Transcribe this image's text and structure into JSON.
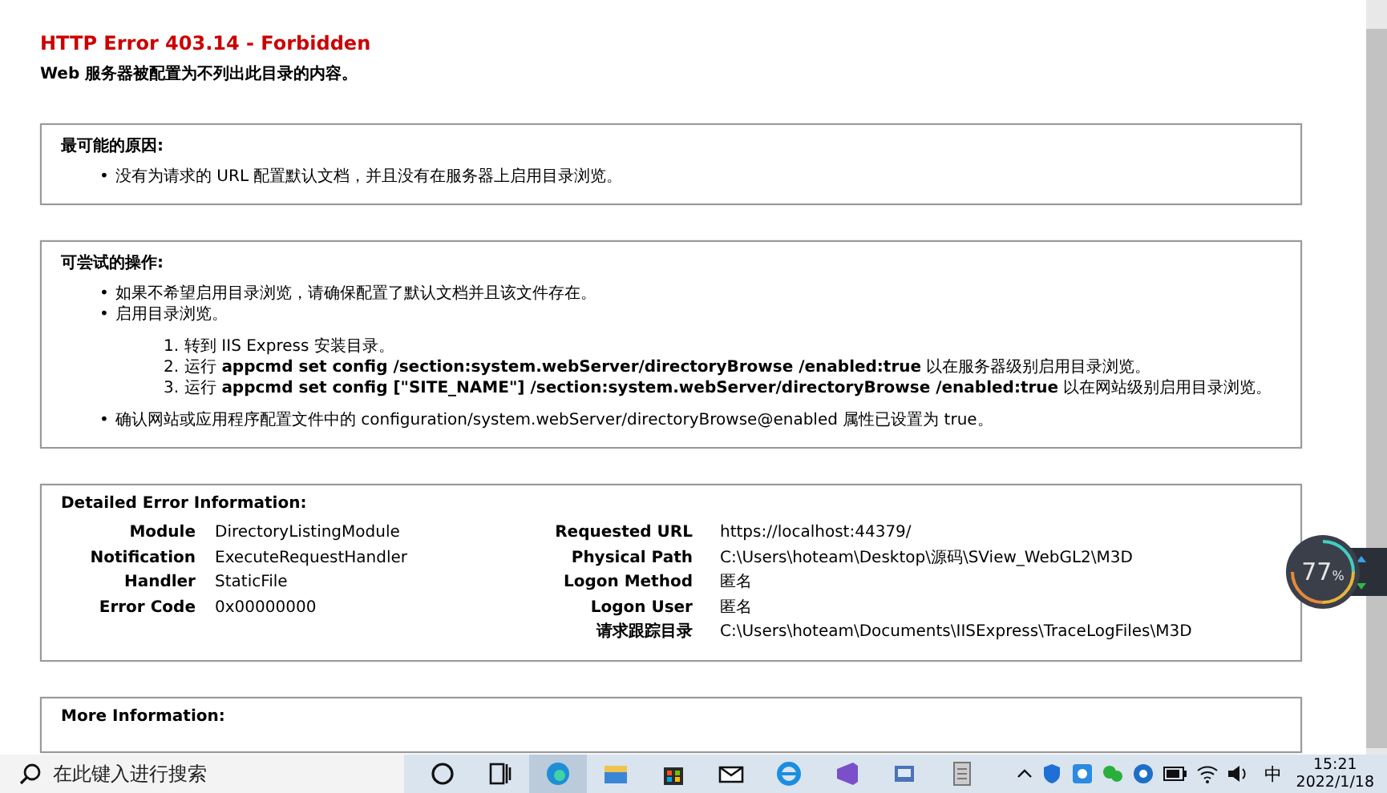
{
  "page": {
    "title": "HTTP Error 403.14 - Forbidden",
    "subtitle": "Web 服务器被配置为不列出此目录的内容。"
  },
  "sections": [
    {
      "kind": "list",
      "heading": "最可能的原因:",
      "items": [
        {
          "marker": "•",
          "text": "没有为请求的 URL 配置默认文档，并且没有在服务器上启用目录浏览。"
        }
      ]
    },
    {
      "kind": "list",
      "heading": "可尝试的操作:",
      "items": [
        {
          "marker": "•",
          "text": "如果不希望启用目录浏览，请确保配置了默认文档并且该文件存在。"
        },
        {
          "marker": "•",
          "text": "启用目录浏览。",
          "steps": [
            {
              "marker": "1.",
              "text": "转到 IIS Express 安装目录。"
            },
            {
              "marker": "2.",
              "text": "运行 **appcmd set config /section:system.webServer/directoryBrowse /enabled:true** 以在服务器级别启用目录浏览。"
            },
            {
              "marker": "3.",
              "text": "运行 **appcmd set config [\"SITE_NAME\"] /section:system.webServer/directoryBrowse /enabled:true** 以在网站级别启用目录浏览。"
            }
          ]
        },
        {
          "marker": "•",
          "text": "确认网站或应用程序配置文件中的 configuration/system.webServer/directoryBrowse@enabled 属性已设置为 true。"
        }
      ]
    },
    {
      "kind": "details",
      "heading": "Detailed Error Information:",
      "left": [
        {
          "label": "Module",
          "value": "DirectoryListingModule"
        },
        {
          "label": "Notification",
          "value": "ExecuteRequestHandler"
        },
        {
          "label": "Handler",
          "value": "StaticFile"
        },
        {
          "label": "Error Code",
          "value": "0x00000000"
        }
      ],
      "right": [
        {
          "label": "Requested URL",
          "value": "https://localhost:44379/"
        },
        {
          "label": "Physical Path",
          "value": "C:\\Users\\hoteam\\Desktop\\源码\\SView_WebGL2\\M3D"
        },
        {
          "label": "Logon Method",
          "value": "匿名"
        },
        {
          "label": "Logon User",
          "value": "匿名"
        },
        {
          "label": "请求跟踪目录",
          "value": "C:\\Users\\hoteam\\Documents\\IISExpress\\TraceLogFiles\\M3D"
        }
      ]
    },
    {
      "kind": "heading_only",
      "heading": "More Information:"
    }
  ],
  "monitor_widget": {
    "value": "77",
    "unit": "%"
  },
  "taskbar": {
    "search_placeholder": "在此键入进行搜索",
    "ime": "中",
    "time": "15:21",
    "date": "2022/1/18"
  }
}
